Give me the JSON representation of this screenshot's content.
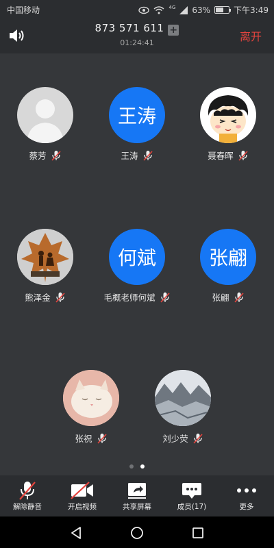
{
  "status_bar": {
    "carrier": "中国移动",
    "battery": "63%",
    "battery_level": 0.63,
    "time": "下午3:49",
    "network": "4G"
  },
  "header": {
    "meeting_id": "873 571 611",
    "duration": "01:24:41",
    "leave_label": "离开"
  },
  "participants": [
    {
      "name": "蔡芳",
      "avatar_type": "default-person",
      "muted": true
    },
    {
      "name": "王涛",
      "avatar_text": "王涛",
      "avatar_type": "text",
      "muted": true
    },
    {
      "name": "聂春晖",
      "avatar_type": "cartoon",
      "muted": true
    },
    {
      "name": "熊泽金",
      "avatar_type": "photo-leaf",
      "muted": true
    },
    {
      "name": "毛概老师何斌",
      "avatar_text": "何斌",
      "avatar_type": "text",
      "muted": true
    },
    {
      "name": "张翩",
      "avatar_text": "张翩",
      "avatar_type": "text",
      "muted": true
    },
    {
      "name": "张祝",
      "avatar_type": "photo-cat",
      "muted": true
    },
    {
      "name": "刘少荧",
      "avatar_type": "photo-painting",
      "muted": true
    }
  ],
  "pager": {
    "pages": 2,
    "current": 2
  },
  "toolbar": {
    "unmute_label": "解除静音",
    "video_label": "开启视频",
    "share_label": "共享屏幕",
    "members_label": "成员(17)",
    "more_label": "更多"
  },
  "colors": {
    "accent_blue": "#1677f5",
    "leave_red": "#e6443e",
    "background": "#35373a",
    "bar": "#2b2d30"
  }
}
